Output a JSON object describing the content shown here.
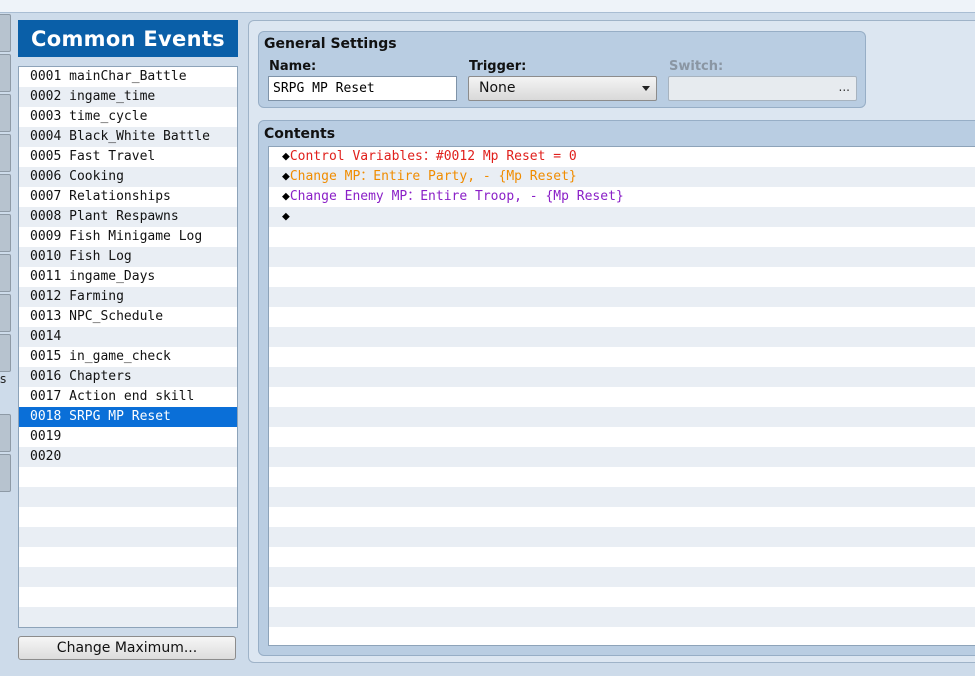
{
  "left_tab_letter": "s",
  "common_events": {
    "title": "Common Events",
    "items": [
      {
        "label": "0001 mainChar_Battle"
      },
      {
        "label": "0002 ingame_time"
      },
      {
        "label": "0003 time_cycle"
      },
      {
        "label": "0004 Black_White Battle"
      },
      {
        "label": "0005 Fast Travel"
      },
      {
        "label": "0006 Cooking"
      },
      {
        "label": "0007 Relationships"
      },
      {
        "label": "0008 Plant Respawns"
      },
      {
        "label": "0009 Fish Minigame Log"
      },
      {
        "label": "0010 Fish Log"
      },
      {
        "label": "0011 ingame_Days"
      },
      {
        "label": "0012 Farming"
      },
      {
        "label": "0013 NPC_Schedule"
      },
      {
        "label": "0014"
      },
      {
        "label": "0015 in_game_check"
      },
      {
        "label": "0016 Chapters"
      },
      {
        "label": "0017 Action end skill"
      },
      {
        "label": "0018 SRPG MP Reset",
        "selected": true
      },
      {
        "label": "0019"
      },
      {
        "label": "0020"
      }
    ],
    "change_maximum_label": "Change Maximum..."
  },
  "general_settings": {
    "title": "General Settings",
    "name_label": "Name:",
    "name_value": "SRPG MP Reset",
    "trigger_label": "Trigger:",
    "trigger_value": "None",
    "switch_label": "Switch:",
    "switch_value": "",
    "switch_button": "..."
  },
  "contents": {
    "title": "Contents",
    "diamond": "◆",
    "commands": [
      {
        "text": "Control Variables：#0012 Mp Reset = 0",
        "color": "#e0201c"
      },
      {
        "text": "Change MP：Entire Party, - {Mp Reset}",
        "color": "#f08c00"
      },
      {
        "text": "Change Enemy MP：Entire Troop, - {Mp Reset}",
        "color": "#8a1fc7"
      },
      {
        "text": "",
        "color": "#000000"
      }
    ]
  }
}
